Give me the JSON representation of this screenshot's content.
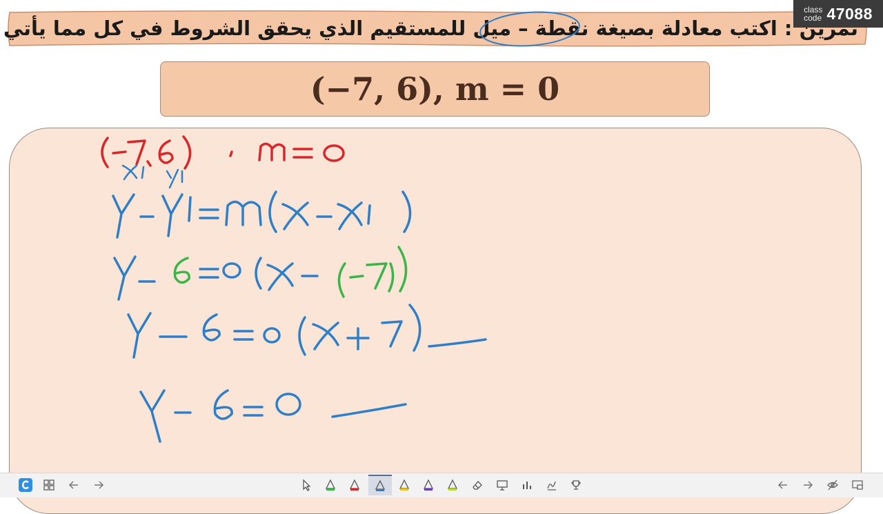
{
  "banner": {
    "instruction": "تمرين : اكتب معادلة بصيغة نقطة – ميل للمستقيم الذي يحقق الشروط في كل مما يأتي :"
  },
  "badge": {
    "label_line1": "class",
    "label_line2": "code",
    "code": "47088"
  },
  "problem": {
    "expression": "(−7, 6), m = 0"
  },
  "handwriting": [
    "(-7,6) , m=0",
    "x1 y1",
    "y-y1=m(x-x1)",
    "y-6=0(x-(-7))",
    "y-6=0(x+7)",
    "y-6=0"
  ],
  "colors": {
    "banner": "#f5c6a5",
    "work_area": "#fae5d6",
    "ink_red": "#d9262b",
    "ink_blue": "#2f7ec8",
    "ink_green": "#3bb54a"
  },
  "toolbar": {
    "left": [
      "app-logo-icon",
      "grid-icon",
      "arrow-left-icon",
      "arrow-right-icon"
    ],
    "center": [
      "pointer-icon",
      "pen-green-icon",
      "pen-red-icon",
      "pen-blue-icon",
      "highlighter-yellow-icon",
      "pen-purple-icon",
      "highlighter-lime-icon",
      "eraser-icon",
      "whiteboard-icon",
      "chart-icon",
      "signature-icon",
      "trophy-icon"
    ],
    "right": [
      "arrow-left-icon",
      "arrow-right-icon",
      "hide-icon",
      "screen-icon"
    ],
    "active_tool": "pen-blue-icon"
  }
}
